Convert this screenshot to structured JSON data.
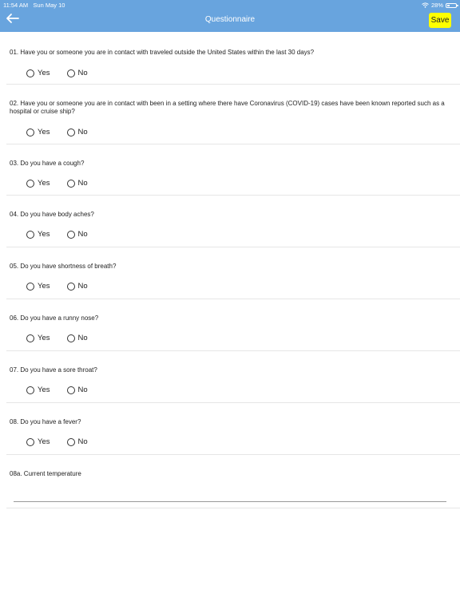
{
  "status": {
    "time": "11:54 AM",
    "date": "Sun May 10",
    "battery": "28%"
  },
  "header": {
    "title": "Questionnaire",
    "save_label": "Save"
  },
  "options": {
    "yes": "Yes",
    "no": "No"
  },
  "questions": [
    {
      "text": "01. Have you or someone you are in contact with traveled outside the United States within the last 30 days?"
    },
    {
      "text": "02. Have you or someone you are in contact with been in a setting where there have Coronavirus (COVID-19) cases have been known  reported such as a hospital or cruise ship?"
    },
    {
      "text": "03. Do you have a cough?"
    },
    {
      "text": "04. Do you have body aches?"
    },
    {
      "text": "05. Do you have shortness of breath?"
    },
    {
      "text": "06. Do you have a runny nose?"
    },
    {
      "text": "07. Do you have a sore throat?"
    },
    {
      "text": "08. Do you have a fever?"
    }
  ],
  "temperature": {
    "label": "08a. Current temperature",
    "value": ""
  }
}
